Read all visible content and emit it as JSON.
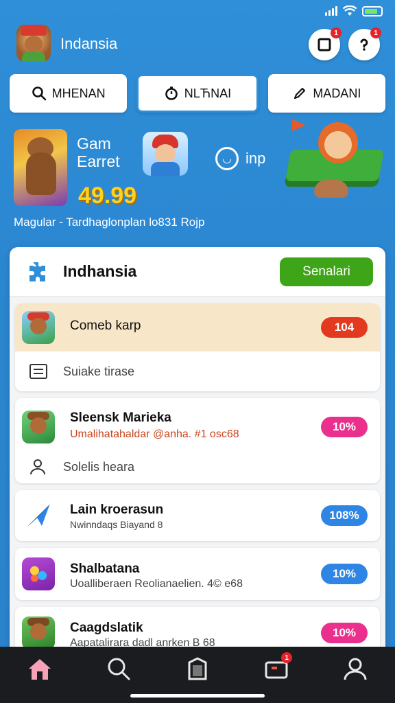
{
  "status": {
    "signal": "signal-icon",
    "wifi": "wifi-icon",
    "battery": "battery-icon"
  },
  "header": {
    "app_name": "Indansia",
    "notification_count_1": "1",
    "notification_count_2": "1"
  },
  "tabs": [
    {
      "label": "MHENAN",
      "icon": "search-icon"
    },
    {
      "label": "NLЋNAI",
      "icon": "timer-icon"
    },
    {
      "label": "MADANI",
      "icon": "pen-icon"
    }
  ],
  "promo": {
    "title": "Gam\nEarret",
    "price": "49.99",
    "inp_label": "inp",
    "tagline": "Magular - Tardhaglonplan lo831 Rojp"
  },
  "panel": {
    "title": "Indhansia",
    "cta": "Senalari"
  },
  "items": [
    {
      "title": "Comeb karp",
      "badge": "104",
      "sub": "Suiake tirase"
    },
    {
      "title": "Sleensk Marieka",
      "meta": "Umalihatahaldar @anha. #1 osc68",
      "badge": "10%",
      "sub": "Solelis heara"
    },
    {
      "title": "Lain kroerasun",
      "meta": "Nwinndaqs Biayand 8",
      "badge": "108%"
    },
    {
      "title": "Shalbatana",
      "meta": "Uoalliberaen Reolianaelien. 4© e68",
      "badge": "10%"
    },
    {
      "title": "Caagdslatik",
      "meta": "Aapatalirara dadl anrken B 68",
      "badge": "10%"
    }
  ],
  "nav": {
    "home": "home-icon",
    "search": "search-icon",
    "library": "library-icon",
    "inbox": "inbox-icon",
    "inbox_badge": "1",
    "profile": "profile-icon"
  },
  "colors": {
    "accent": "#2f8fd8",
    "cta": "#3ea519",
    "badge_red": "#e2391f",
    "badge_pink": "#ea2f8c",
    "badge_blue": "#2f85e3"
  }
}
